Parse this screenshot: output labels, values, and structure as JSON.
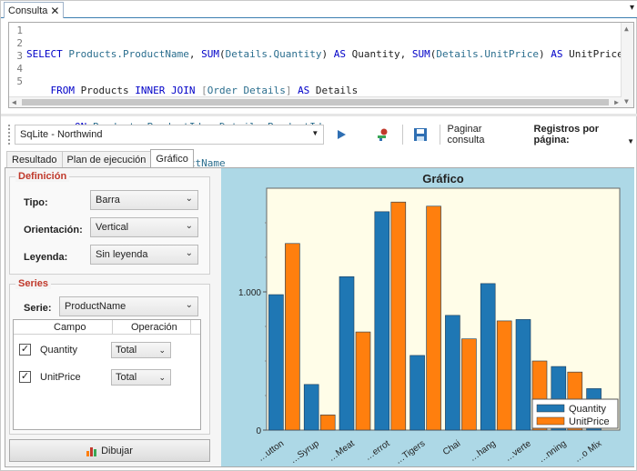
{
  "doc_tab": {
    "label": "Consulta",
    "close": "✕",
    "pin": "▾"
  },
  "editor": {
    "line_numbers": [
      "1",
      "2",
      "3",
      "4",
      "5"
    ]
  },
  "toolbar": {
    "connection": "SqLite - Northwind",
    "paginate_label": "Paginar consulta",
    "records_label": "Registros por página:"
  },
  "result_tabs": [
    "Resultado",
    "Plan de ejecución",
    "Gráfico"
  ],
  "definition": {
    "title": "Definición",
    "type_label": "Tipo:",
    "type_value": "Barra",
    "orientation_label": "Orientación:",
    "orientation_value": "Vertical",
    "legend_label": "Leyenda:",
    "legend_value": "Sin leyenda"
  },
  "series": {
    "title": "Series",
    "serie_label": "Serie:",
    "serie_value": "ProductName",
    "col_field": "Campo",
    "col_operation": "Operación",
    "rows": [
      {
        "field": "Quantity",
        "operation": "Total",
        "checked": true
      },
      {
        "field": "UnitPrice",
        "operation": "Total",
        "checked": true
      }
    ]
  },
  "draw_button": "Dibujar",
  "colors": {
    "quantity": "#1f77b4",
    "unitprice": "#ff7f0e",
    "panel": "#add8e6",
    "plot_bg": "#fffde8"
  },
  "chart_data": {
    "type": "bar",
    "title": "Gráfico",
    "categories": [
      "…utton",
      "…Syrup",
      "…Meat",
      "…errot",
      "…Tigers",
      "Chai",
      "…hang",
      "…verte",
      "…nning",
      "…o Mix"
    ],
    "series": [
      {
        "name": "Quantity",
        "values": [
          980,
          330,
          1110,
          1580,
          540,
          830,
          1060,
          800,
          460,
          300
        ]
      },
      {
        "name": "UnitPrice",
        "values": [
          1350,
          110,
          710,
          1650,
          1620,
          660,
          790,
          500,
          420,
          0
        ]
      }
    ],
    "y_ticks": [
      "0",
      "1.000"
    ],
    "ylim": [
      0,
      1750
    ],
    "legend": "bottom-right",
    "grid": false
  }
}
